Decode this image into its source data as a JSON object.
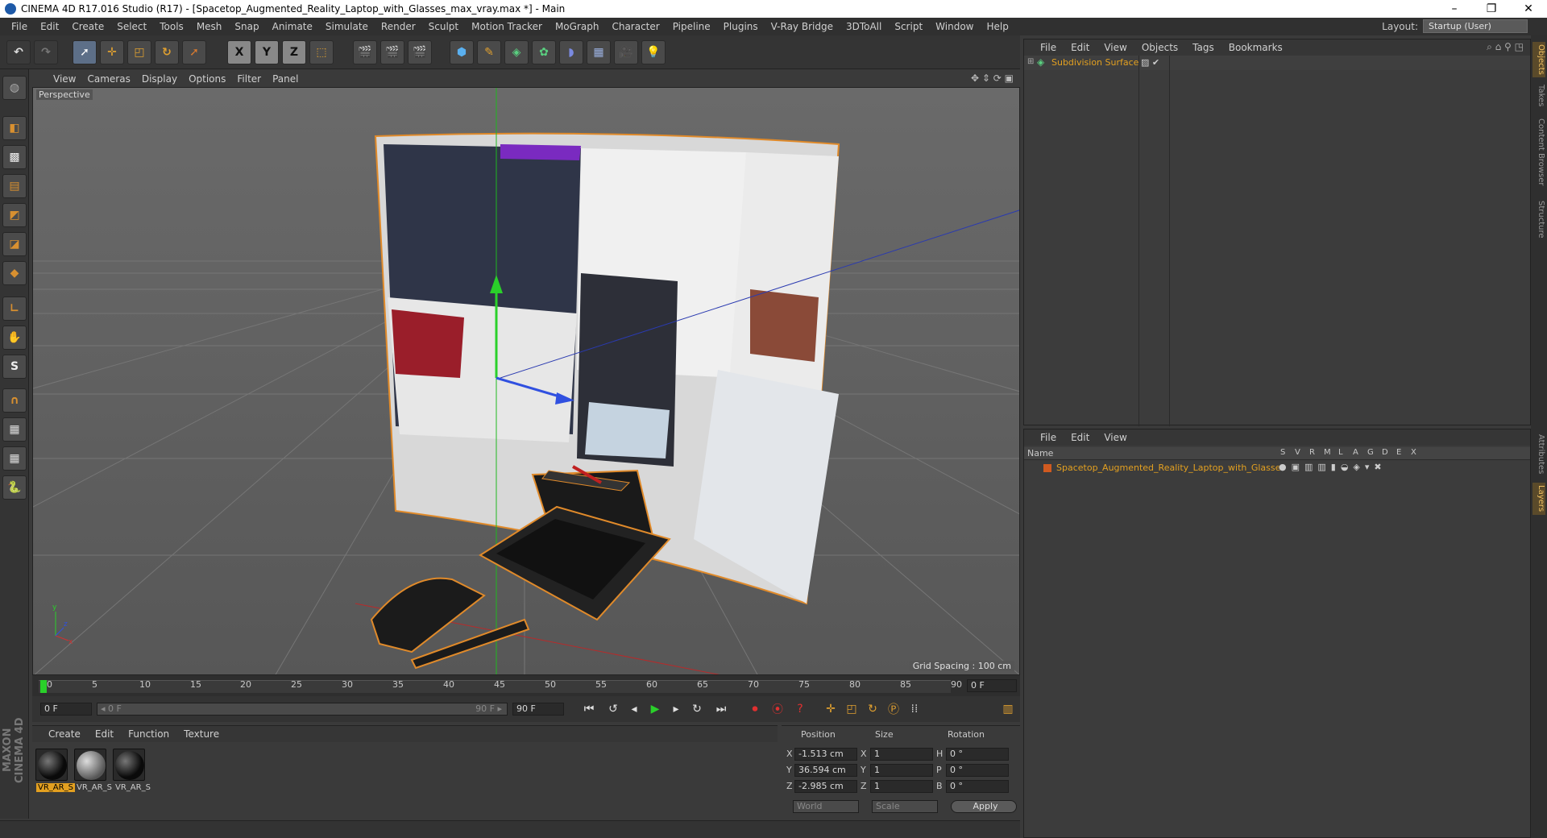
{
  "window": {
    "title": "CINEMA 4D R17.016 Studio (R17) - [Spacetop_Augmented_Reality_Laptop_with_Glasses_max_vray.max *] - Main",
    "controls": [
      "–",
      "❐",
      "✕"
    ]
  },
  "menubar": {
    "items": [
      "File",
      "Edit",
      "Create",
      "Select",
      "Tools",
      "Mesh",
      "Snap",
      "Animate",
      "Simulate",
      "Render",
      "Sculpt",
      "Motion Tracker",
      "MoGraph",
      "Character",
      "Pipeline",
      "Plugins",
      "V-Ray Bridge",
      "3DToAll",
      "Script",
      "Window",
      "Help"
    ],
    "layout_label": "Layout:",
    "layout_value": "Startup (User)"
  },
  "toolbar": {
    "axis_x": "X",
    "axis_y": "Y",
    "axis_z": "Z"
  },
  "viewport": {
    "menu": [
      "View",
      "Cameras",
      "Display",
      "Options",
      "Filter",
      "Panel"
    ],
    "label": "Perspective",
    "grid_spacing": "Grid Spacing : 100 cm"
  },
  "timeline": {
    "ticks": [
      "0",
      "5",
      "10",
      "15",
      "20",
      "25",
      "30",
      "35",
      "40",
      "45",
      "50",
      "55",
      "60",
      "65",
      "70",
      "75",
      "80",
      "85",
      "90"
    ],
    "end_frame": "0 F"
  },
  "transport": {
    "current": "0 F",
    "range_start": "◂ 0 F",
    "range_end": "90 F ▸",
    "max_frame": "90 F"
  },
  "material_manager": {
    "menu": [
      "Create",
      "Edit",
      "Function",
      "Texture"
    ],
    "materials": [
      "VR_AR_S",
      "VR_AR_S",
      "VR_AR_S"
    ]
  },
  "coordinates": {
    "headers": [
      "Position",
      "Size",
      "Rotation"
    ],
    "rows": [
      {
        "axis": "X",
        "pos": "-1.513 cm",
        "size_axis": "X",
        "size": "1",
        "rot_axis": "H",
        "rot": "0 °"
      },
      {
        "axis": "Y",
        "pos": "36.594 cm",
        "size_axis": "Y",
        "size": "1",
        "rot_axis": "P",
        "rot": "0 °"
      },
      {
        "axis": "Z",
        "pos": "-2.985 cm",
        "size_axis": "Z",
        "size": "1",
        "rot_axis": "B",
        "rot": "0 °"
      }
    ],
    "mode": "World",
    "size_mode": "Scale",
    "apply": "Apply"
  },
  "object_manager": {
    "menu": [
      "File",
      "Edit",
      "View",
      "Objects",
      "Tags",
      "Bookmarks"
    ],
    "objects": [
      "Subdivision Surface"
    ]
  },
  "layer_manager": {
    "menu": [
      "File",
      "Edit",
      "View"
    ],
    "col_name": "Name",
    "col_flags": [
      "S",
      "V",
      "R",
      "M",
      "L",
      "A",
      "G",
      "D",
      "E",
      "X"
    ],
    "layers": [
      "Spacetop_Augmented_Reality_Laptop_with_Glasses"
    ]
  },
  "side_tabs": {
    "top": [
      "Objects",
      "Takes",
      "Content Browser",
      "Structure"
    ],
    "bottom": [
      "Attributes",
      "Layers"
    ]
  },
  "branding": {
    "logo": "MAXON CINEMA 4D"
  },
  "colors": {
    "accent": "#e3a020",
    "selection_outline": "#e08a2a"
  }
}
